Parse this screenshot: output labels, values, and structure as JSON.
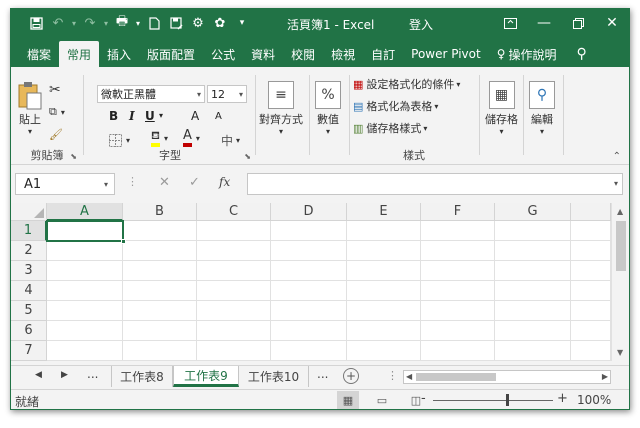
{
  "title_bar": {
    "title": "活頁簿1 - Excel",
    "login": "登入",
    "quick_access": [
      "save-icon",
      "undo-icon",
      "redo-icon",
      "print-preview-icon",
      "new-icon",
      "save-as-icon",
      "share-icon",
      "settings-icon",
      "customize-icon"
    ]
  },
  "menu": {
    "tabs": [
      "檔案",
      "常用",
      "插入",
      "版面配置",
      "公式",
      "資料",
      "校閱",
      "檢視",
      "自訂",
      "Power Pivot",
      "操作說明"
    ],
    "active_tab": "常用"
  },
  "ribbon": {
    "clipboard": {
      "paste": "貼上",
      "label": "剪貼簿"
    },
    "font": {
      "label": "字型",
      "font_name": "微軟正黑體",
      "font_size": "12",
      "bold": "B",
      "italic": "I",
      "underline": "U",
      "grow": "A",
      "shrink": "A",
      "font_color_letter": "A",
      "phonetic": "中"
    },
    "alignment": {
      "label": "對齊方式"
    },
    "number": {
      "label": "數值",
      "icon_text": "%"
    },
    "styles": {
      "label": "樣式",
      "items": [
        "設定格式化的條件",
        "格式化為表格",
        "儲存格樣式"
      ]
    },
    "cells": {
      "label": "儲存格"
    },
    "editing": {
      "label": "編輯"
    },
    "accent": "#217346",
    "font_color": "#c00000",
    "fill_color": "#ffff00"
  },
  "formula_bar": {
    "name_box": "A1",
    "cancel": "✕",
    "enter": "✓",
    "fx": "fx",
    "formula": ""
  },
  "grid": {
    "columns": [
      "A",
      "B",
      "C",
      "D",
      "E",
      "F",
      "G"
    ],
    "rows": [
      "1",
      "2",
      "3",
      "4",
      "5",
      "6",
      "7"
    ],
    "active_cell": "A1"
  },
  "sheets": {
    "more_left": "...",
    "tabs": [
      "工作表8",
      "工作表9",
      "工作表10"
    ],
    "active": "工作表9",
    "more_right": "...",
    "add": "+"
  },
  "status": {
    "ready": "就緒",
    "zoom": "100%",
    "zoom_minus": "-",
    "zoom_plus": "+"
  }
}
